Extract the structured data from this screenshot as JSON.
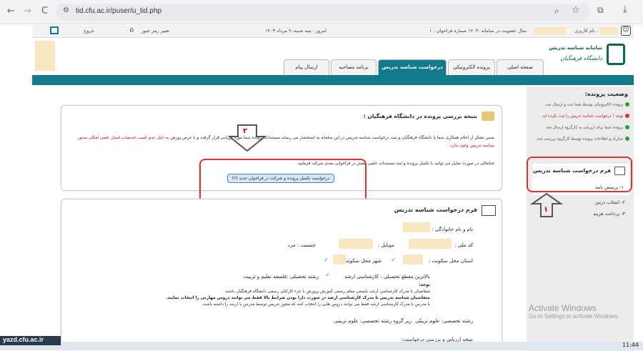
{
  "browser": {
    "url": "tid.cfu.ac.ir/puser/u_tid.php",
    "back": "←",
    "forward": "→",
    "reload": "C"
  },
  "header": {
    "exit": "خروج",
    "change_password": "تغییر رمز عبور",
    "today": "امروز : سه شنبه، ۹ مرداد ۱۴۰۳",
    "membership": "سال عضویت در سامانه :۱۴۰۳ شماره فراخوان : ۱",
    "username": "، نام کاربری"
  },
  "logo": {
    "line1": "سامانه شناسه تدریس",
    "line2": "دانشگاه فرهنگیان"
  },
  "tabs": [
    {
      "label": "صفحه اصلی"
    },
    {
      "label": "پرونده الکترونیکی"
    },
    {
      "label": "درخواست شناسه تدریس"
    },
    {
      "label": "برنامه مصاحبه"
    },
    {
      "label": "ارسال پیام"
    }
  ],
  "sidebar": {
    "title": "وضعیت پرونده:",
    "items": [
      {
        "label": "پرونده الکترونیکی توسط شما ثبت و ارسال شد.",
        "status": "ok"
      },
      {
        "label": "توجه ! درخواست شناسه تدریس را ثبت نکرده اید.",
        "status": "warn"
      },
      {
        "label": "پرونده شما برای ارزیابی به کارگروه ارسال شد.",
        "status": "ok"
      },
      {
        "label": "مدارک و اطلاعات پرونده توسط کارگروه بررسی شد.",
        "status": "ok"
      }
    ],
    "menu_title": "فرم درخواست شناسه تدریس",
    "menu_items": [
      "۱- پرسش نامه",
      "۲- انتخاب درس",
      "۳- پرداخت هزینه"
    ]
  },
  "annotations": {
    "num1": "۱",
    "num2": "۲"
  },
  "result": {
    "title": "نتیجه بررسی پرونده در دانشگاه فرهنگیان :",
    "text1": "ضمن تشکر از اعلام همکاری شما با دانشگاه فرهنگیان و ثبت درخواست شناسه تدریس در این سامانه به استحضار می رساند مستندات پرونده شما مورد ارزیابی قرار گرفت و با عرض پوزش",
    "text1_red": "به دلیل عدم کسب حدنصاب امتیاز علمی امکان صدور شناسه تدریس وجود ندارد.",
    "text2": "جنابعالی در صورت تمایل می توانید با تکمیل پرونده و ثبت مستندات علمی بیشتر در فراخوانی بعدی شرکت فرمایید.",
    "button": "درخواست تکمیل پرونده و شرکت در فراخوان جدید (۲)"
  },
  "form": {
    "title": "فرم درخواست شناسه تدریس",
    "name_label": "نام و نام خانوادگی :",
    "code_label": "کد ملی :",
    "mobile_label": "موبایل :",
    "gender_label": "جنسیت : مرد",
    "province_label": "استان محل سکونت :",
    "city_label": "شهر محل سکونت :",
    "degree": "بالاترین مقطع تحصیلی : کارشناسی ارشد",
    "field": "رشته تحصیلی :فلسفه تعلیم و تربیت",
    "note_title": "توجه:",
    "note1": "متقاضیان با مدرک کارشناسی ارشد بایستی معلم رسمی آموزش پرورش یا جزء کارکنان رسمی دانشگاه فرهنگیان باشند.",
    "note2": "متقاضیان شناسه تدریس با مدرک کارشناسی ارشد در صورت دارا بودن شرایط بالا فقط می توانند دروس مهارتی را انتخاب نمایند.",
    "note3": "با مدرس با مدرک کارشناسی ارشد فقط می توانند دروس هایی را انتخاب کنند که مجوز تدریس توسط مدرس با ارشد را داشته باشند.",
    "specialty": "رشته تخصصی: علوم تربیتی",
    "subgroup": "زیر گروه رشته تخصصی: علوم تربیتی",
    "evaluation": "نتیجه ارزیابی و بررسی درخواست:"
  },
  "watermark": {
    "title": "Activate Windows",
    "sub": "Go to Settings to activate Windows."
  },
  "footer": {
    "site": "yazd.cfu.ac.ir",
    "time": "11:44"
  }
}
